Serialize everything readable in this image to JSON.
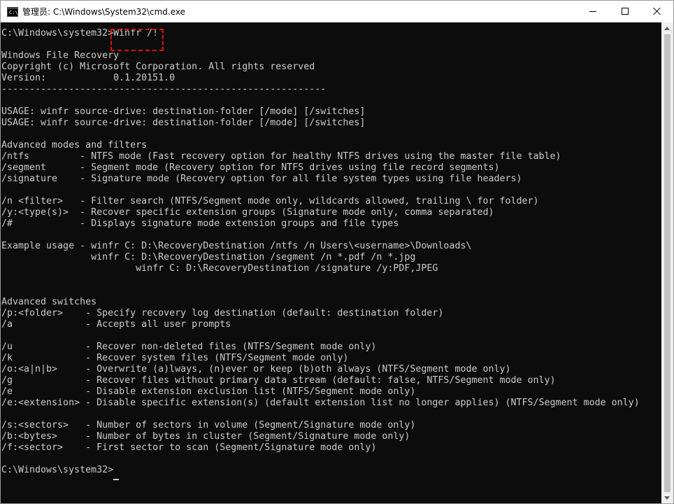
{
  "window": {
    "title": "管理员: C:\\Windows\\System32\\cmd.exe",
    "icon": "cmd-icon",
    "icon_text": "C:\\",
    "controls": [
      "minimize-icon",
      "maximize-icon",
      "close-icon"
    ]
  },
  "console": {
    "text": "C:\\Windows\\system32>Winfr /!\n\nWindows File Recovery\nCopyright (c) Microsoft Corporation. All rights reserved\nVersion:            0.1.20151.0\n----------------------------------------------------------\n\nUSAGE: winfr source-drive: destination-folder [/mode] [/switches]\nUSAGE: winfr source-drive: destination-folder [/mode] [/switches]\n\nAdvanced modes and filters\n/ntfs         - NTFS mode (Fast recovery option for healthy NTFS drives using the master file table)\n/segment      - Segment mode (Recovery option for NTFS drives using file record segments)\n/signature    - Signature mode (Recovery option for all file system types using file headers)\n\n/n <filter>   - Filter search (NTFS/Segment mode only, wildcards allowed, trailing \\ for folder)\n/y:<type(s)>  - Recover specific extension groups (Signature mode only, comma separated)\n/#            - Displays signature mode extension groups and file types\n\nExample usage - winfr C: D:\\RecoveryDestination /ntfs /n Users\\<username>\\Downloads\\\n                winfr C: D:\\RecoveryDestination /segment /n *.pdf /n *.jpg\n                        winfr C: D:\\RecoveryDestination /signature /y:PDF,JPEG\n\n\nAdvanced switches\n/p:<folder>    - Specify recovery log destination (default: destination folder)\n/a             - Accepts all user prompts\n\n/u             - Recover non-deleted files (NTFS/Segment mode only)\n/k             - Recover system files (NTFS/Segment mode only)\n/o:<a|n|b>     - Overwrite (a)lways, (n)ever or keep (b)oth always (NTFS/Segment mode only)\n/g             - Recover files without primary data stream (default: false, NTFS/Segment mode only)\n/e             - Disable extension exclusion list (NTFS/Segment mode only)\n/e:<extension> - Disable specific extension(s) (default extension list no longer applies) (NTFS/Segment mode only)\n\n/s:<sectors>   - Number of sectors in volume (Segment/Signature mode only)\n/b:<bytes>     - Number of bytes in cluster (Segment/Signature mode only)\n/f:<sector>    - First sector to scan (Segment/Signature mode only)\n\nC:\\Windows\\system32>"
  },
  "colors": {
    "console_bg": "#0c0c0c",
    "console_fg": "#cccccc",
    "highlight": "#e01010",
    "titlebar_bg": "#ffffff"
  }
}
